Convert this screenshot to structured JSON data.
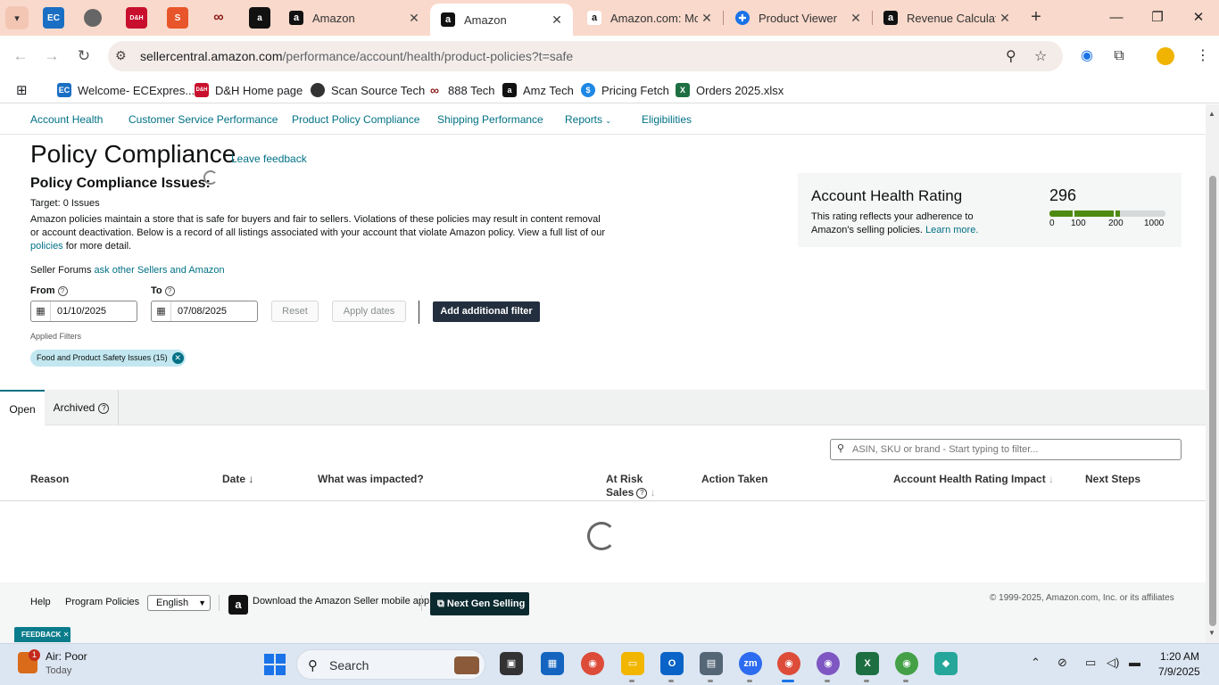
{
  "browser": {
    "tabs": [
      {
        "title": "Amazon",
        "active": false
      },
      {
        "title": "Amazon",
        "active": true
      },
      {
        "title": "Amazon.com: Mc",
        "active": false
      },
      {
        "title": "Product Viewer",
        "active": false
      },
      {
        "title": "Revenue Calculat",
        "active": false
      }
    ],
    "url_host": "sellercentral.amazon.com",
    "url_path": "/performance/account/health/product-policies?t=safe",
    "bookmarks": [
      {
        "label": "Welcome- ECExpres...",
        "icon": "ec-icon",
        "color": "#1a6fc4"
      },
      {
        "label": "D&H Home page",
        "icon": "dh-icon",
        "color": "#c8102e"
      },
      {
        "label": "Scan Source Tech",
        "icon": "globe-icon",
        "color": "#333333"
      },
      {
        "label": "888 Tech",
        "icon": "888-icon",
        "color": "#8b1a1a"
      },
      {
        "label": "Amz Tech",
        "icon": "amazon-icon",
        "color": "#111111"
      },
      {
        "label": "Pricing Fetch",
        "icon": "dollar-icon",
        "color": "#1e88e5"
      },
      {
        "label": "Orders 2025.xlsx",
        "icon": "excel-icon",
        "color": "#1d6f42"
      }
    ]
  },
  "subnav": {
    "items": [
      "Account Health",
      "Customer Service Performance",
      "Product Policy Compliance",
      "Shipping Performance",
      "Reports",
      "Eligibilities"
    ]
  },
  "page": {
    "title": "Policy Compliance",
    "leave_feedback": "Leave feedback",
    "issues_heading": "Policy Compliance Issues:",
    "target_label": "Target",
    "target_value": ": 0 Issues",
    "desc_text": "Amazon policies maintain a store that is safe for buyers and fair to sellers. Violations of these policies may result in content removal or account deactivation. Below is a record of all listings associated with your account that violate Amazon policy. View a full list of our",
    "desc_link": "policies",
    "desc_tail": " for more detail.",
    "forums_text": "Seller Forums ",
    "forums_link": "ask other Sellers and Amazon"
  },
  "ahr": {
    "title": "Account Health Rating",
    "desc": "This rating reflects your adherence to Amazon's selling policies.",
    "learn_more": "Learn more.",
    "score": "296",
    "score_value": 296,
    "ticks": [
      "0",
      "100",
      "200",
      "1000"
    ],
    "color": "#4f8a10"
  },
  "filters": {
    "from_label": "From",
    "to_label": "To",
    "from_value": "01/10/2025",
    "to_value": "07/08/2025",
    "reset": "Reset",
    "apply": "Apply dates",
    "add_filter": "Add additional filter",
    "applied_label": "Applied Filters",
    "chip": "Food and Product Safety Issues (15)"
  },
  "tabs": {
    "open": "Open",
    "archived": "Archived"
  },
  "table": {
    "filter_placeholder": "ASIN, SKU or brand - Start typing to filter...",
    "columns": [
      "Reason",
      "Date",
      "What was impacted?",
      "At Risk",
      "Sales",
      "Action Taken",
      "Account Health Rating Impact",
      "Next Steps"
    ]
  },
  "footer": {
    "help": "Help",
    "program_policies": "Program Policies",
    "language": "English",
    "app_download": "Download the Amazon Seller mobile app",
    "next_gen": "Next Gen Selling",
    "copyright": "© 1999-2025, Amazon.com, Inc. or its affiliates",
    "feedback": "FEEDBACK"
  },
  "taskbar": {
    "weather_title": "Air: Poor",
    "weather_sub": "Today",
    "weather_badge": "1",
    "search": "Search",
    "time": "1:20 AM",
    "date": "7/9/2025"
  }
}
